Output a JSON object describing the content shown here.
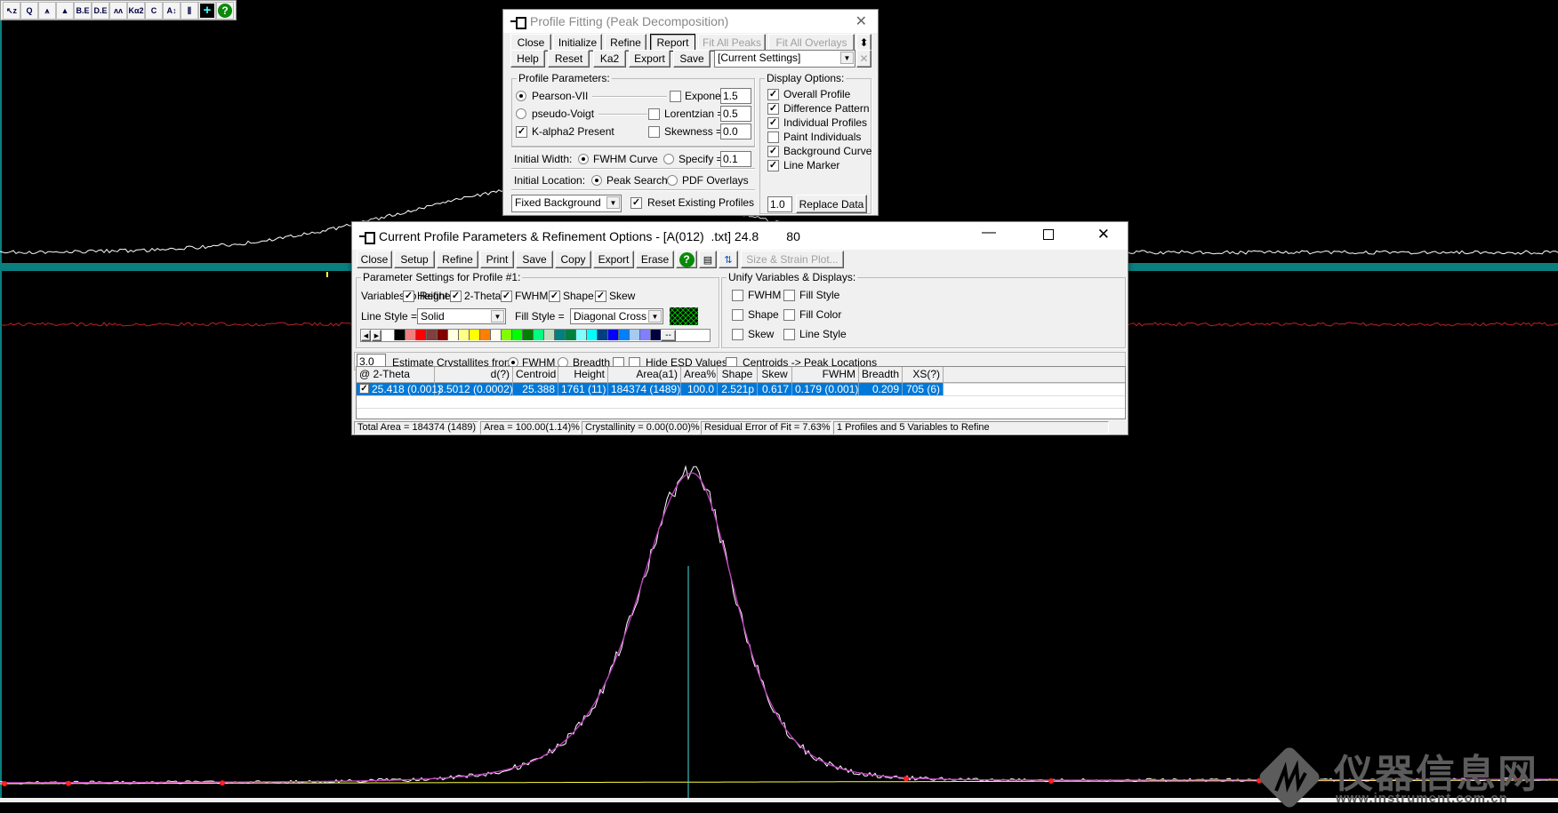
{
  "toolbar": {
    "items": [
      {
        "icon": "cursor-zoom-icon",
        "label": "↖z"
      },
      {
        "icon": "magnify-icon",
        "label": "Q"
      },
      {
        "icon": "peak-search-icon",
        "label": "⩚"
      },
      {
        "icon": "peak-fill-icon",
        "label": "▲"
      },
      {
        "icon": "be-icon",
        "label": "B.E"
      },
      {
        "icon": "de-icon",
        "label": "D.E"
      },
      {
        "icon": "peaks-icon",
        "label": "ʌʌ"
      },
      {
        "icon": "ka2-icon",
        "label": "Kα2"
      },
      {
        "icon": "centroid-icon",
        "label": "C"
      },
      {
        "icon": "scale-peaks-icon",
        "label": "A↕"
      },
      {
        "icon": "scale-bars-icon",
        "label": "⫼"
      },
      {
        "icon": "crosshair-icon",
        "label": "+"
      },
      {
        "icon": "help-icon",
        "label": "?"
      }
    ]
  },
  "profile_fitting": {
    "title": "Profile Fitting (Peak Decomposition)",
    "row1": [
      "Close",
      "Initialize",
      "Refine",
      "Report",
      "Fit All Peaks",
      "Fit All Overlays"
    ],
    "row2": [
      "Help",
      "Reset",
      "Ka2",
      "Export",
      "Save"
    ],
    "settings_value": "[Current Settings]",
    "profile_params": {
      "label": "Profile Parameters:",
      "pearson": "Pearson-VII",
      "pvoigt": "pseudo-Voigt",
      "ka2": "K-alpha2 Present",
      "exponent_label": "Exponent =",
      "exponent": "1.5",
      "lorentzian_label": "Lorentzian =",
      "lorentzian": "0.5",
      "skew_label": "Skewness =",
      "skew": "0.0"
    },
    "initial_width": {
      "label": "Initial Width:",
      "fwhm": "FWHM Curve",
      "specify": "Specify =",
      "value": "0.1"
    },
    "initial_location": {
      "label": "Initial Location:",
      "peak": "Peak Search",
      "pdf": "PDF Overlays"
    },
    "background": "Fixed Background",
    "reset_existing": "Reset Existing Profiles",
    "display": {
      "label": "Display Options:",
      "items": [
        {
          "label": "Overall Profile",
          "checked": true
        },
        {
          "label": "Difference Pattern",
          "checked": true
        },
        {
          "label": "Individual Profiles",
          "checked": true
        },
        {
          "label": "Paint Individuals",
          "checked": false
        },
        {
          "label": "Background Curve",
          "checked": true
        },
        {
          "label": "Line Marker",
          "checked": true
        }
      ]
    },
    "replace_value": "1.0",
    "replace_label": "Replace Data"
  },
  "current_profile": {
    "title": "Current Profile Parameters & Refinement Options - [A(012)  .txt] 24.8        80",
    "buttons": [
      "Close",
      "Setup",
      "Refine",
      "Print",
      "Save",
      "Copy",
      "Export",
      "Erase"
    ],
    "size_strain": "Size & Strain Plot...",
    "param_group": "Parameter Settings for Profile #1:",
    "vars_label": "Variables to Refine:",
    "vars": [
      "Height",
      "2-Theta",
      "FWHM",
      "Shape",
      "Skew"
    ],
    "line_style_label": "Line Style =",
    "line_style": "Solid",
    "fill_style_label": "Fill Style =",
    "fill_style": "Diagonal Cross",
    "palette": [
      "#ffffff",
      "#000000",
      "#f08080",
      "#ff0000",
      "#804040",
      "#800000",
      "#ffffe0",
      "#ffff80",
      "#ffff00",
      "#ff8000",
      "#fffff0",
      "#80ff00",
      "#00ff00",
      "#008000",
      "#00ff80",
      "#c0dcc0",
      "#008080",
      "#008040",
      "#80ffff",
      "#00ffff",
      "#004080",
      "#0000ff",
      "#0080ff",
      "#a6caf0",
      "#8080ff",
      "#000040"
    ],
    "palette_more": "--",
    "unify": {
      "label": "Unify Variables & Displays:",
      "items": [
        "FWHM",
        "Fill Style",
        "Shape",
        "Fill Color",
        "Skew",
        "Line Style"
      ]
    },
    "crystallite_value": "3.0",
    "estimate_label": "Estimate Crystallites from:",
    "fwhm": "FWHM",
    "breadth": "Breadth",
    "hide_esd": "Hide ESD Values",
    "centroids": "Centroids -> Peak Locations",
    "columns": [
      "@ 2-Theta",
      "d(?)",
      "Centroid",
      "Height",
      "Area(a1)",
      "Area%",
      "Shape",
      "Skew",
      "FWHM",
      "Breadth",
      "XS(?)"
    ],
    "rows": [
      [
        "25.418 (0.001)",
        "3.5012 (0.0002)",
        "25.388",
        "1761 (11)",
        "184374 (1489)",
        "100.0",
        "2.521p",
        "0.617",
        "0.179 (0.001)",
        "0.209",
        "705 (6)"
      ]
    ],
    "status": [
      "Total Area = 184374 (1489)",
      "Area = 100.00(1.14)%",
      "Crystallinity = 0.00(0.00)%",
      "Residual Error of Fit = 7.63%",
      "1 Profiles and 5 Variables to Refine"
    ]
  },
  "watermark": {
    "cn": "仪器信息网",
    "url": "www.instrument.com.cn"
  },
  "colors": {
    "observed": "#ffffff",
    "fit": "#c040c0",
    "difference": "#c02020",
    "background": "#ffff40",
    "marker": "#40e0e0",
    "band": "#0a7f80",
    "selection": "#0078d7"
  }
}
